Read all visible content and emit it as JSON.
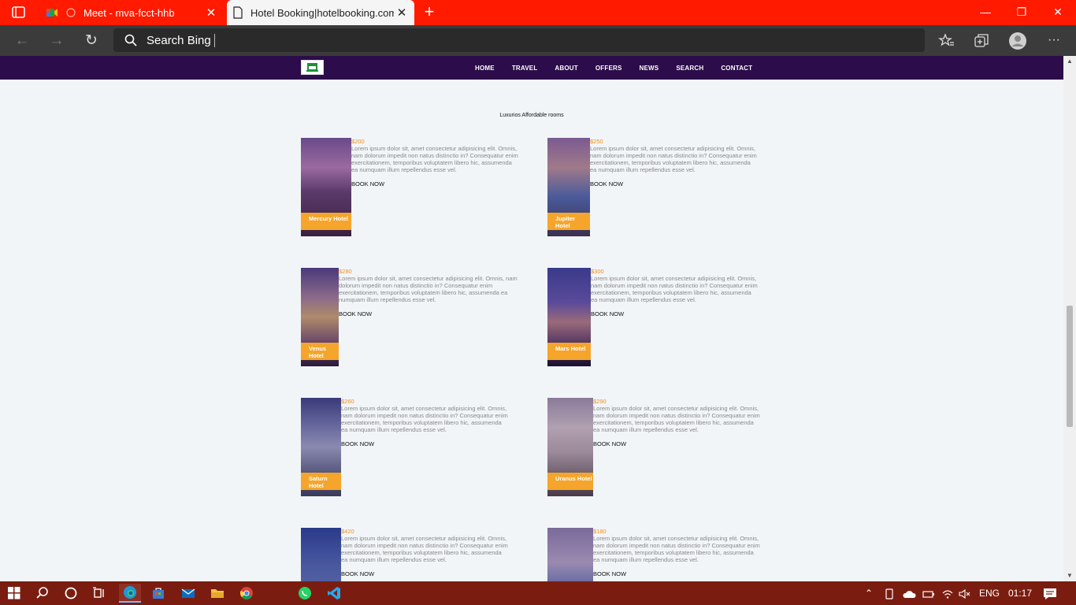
{
  "browser": {
    "tabs": [
      {
        "title": "Meet - mva-fcct-hhb"
      },
      {
        "title": "Hotel Booking|hotelbooking.com"
      }
    ],
    "address": {
      "placeholder": "Search Bing"
    }
  },
  "site": {
    "menu": [
      "HOME",
      "TRAVEL",
      "ABOUT",
      "OFFERS",
      "NEWS",
      "SEARCH",
      "CONTACT"
    ],
    "section_title": "Luxurios Affordable rooms",
    "book_label": "BOOK NOW",
    "description": "Lorem ipsum dolor sit, amet consectetur adipisicing elit. Omnis, nam dolorum impedit non natus distinctio in? Consequatur enim exercitationem, temporibus voluptatem libero hic, assumenda ea numquam illum repellendus esse vel.",
    "hotels": [
      {
        "name": "Mercury Hotel",
        "price": "$200"
      },
      {
        "name": "Jupiter Hotel",
        "price": "$250"
      },
      {
        "name": "Venus Hotel",
        "price": "$280"
      },
      {
        "name": "Mars Hotel",
        "price": "$300"
      },
      {
        "name": "Saturn Hotel",
        "price": "$260"
      },
      {
        "name": "Uranus Hotel",
        "price": "$290"
      },
      {
        "name": "",
        "price": "$420"
      },
      {
        "name": "",
        "price": "$180"
      }
    ]
  },
  "taskbar": {
    "language": "ENG",
    "time": "01:17"
  },
  "colors": {
    "tabbar": "#ff1a00",
    "site_nav": "#2c0c4a",
    "accent": "#f5a52b",
    "taskbar": "#7a1d10"
  }
}
